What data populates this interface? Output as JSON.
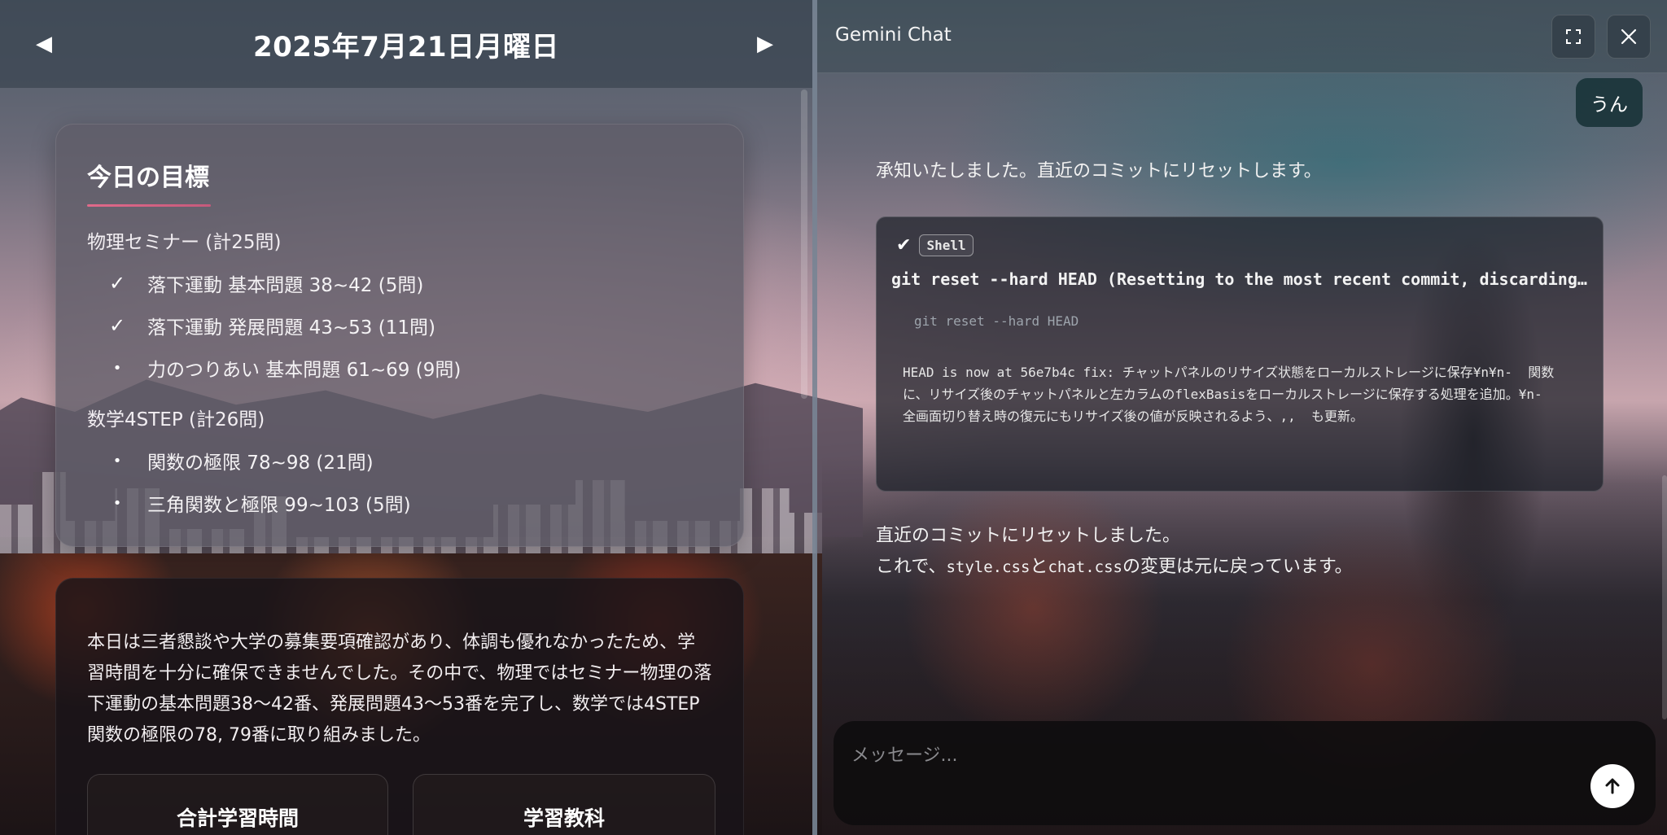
{
  "diary": {
    "date_title": "2025年7月21日月曜日",
    "prev_icon": "triangle-left-icon",
    "next_icon": "triangle-right-icon",
    "goals": {
      "title": "今日の目標",
      "groups": [
        {
          "title": "物理セミナー (計25問)",
          "items": [
            {
              "mark": "✓",
              "status": "done",
              "text": "落下運動 基本問題 38~42 (5問)"
            },
            {
              "mark": "✓",
              "status": "done",
              "text": "落下運動 発展問題 43~53 (11問)"
            },
            {
              "mark": "•",
              "status": "todo",
              "text": "力のつりあい 基本問題 61~69 (9問)"
            }
          ]
        },
        {
          "title": "数学4STEP (計26問)",
          "items": [
            {
              "mark": "•",
              "status": "todo",
              "text": "関数の極限 78~98 (21問)"
            },
            {
              "mark": "•",
              "status": "todo",
              "text": "三角関数と極限 99~103 (5問)"
            }
          ]
        }
      ]
    },
    "summary": {
      "text": "本日は三者懇談や大学の募集要項確認があり、体調も優れなかったため、学習時間を十分に確保できませんでした。その中で、物理ではセミナー物理の落下運動の基本問題38〜42番、発展問題43〜53番を完了し、数学では4STEP 関数の極限の78, 79番に取り組みました。",
      "stats": [
        {
          "label": "合計学習時間"
        },
        {
          "label": "学習教科"
        }
      ]
    }
  },
  "chat": {
    "title": "Gemini Chat",
    "expand_icon": "fullscreen-icon",
    "close_icon": "close-icon",
    "user_message": "うん",
    "ai_message_1": "承知いたしました。直近のコミットにリセットします。",
    "tool": {
      "status_icon": "check-icon",
      "badge": "Shell",
      "command": "git reset --hard HEAD (Resetting to the most recent commit, discarding all loc…",
      "sub_command": "git reset --hard HEAD",
      "output": "HEAD is now at 56e7b4c fix: チャットパネルのリサイズ状態をローカルストレージに保存¥n¥n-  関数\nに、リサイズ後のチャットパネルと左カラムのflexBasisをローカルストレージに保存する処理を追加。¥n-\n全画面切り替え時の復元にもリサイズ後の値が反映されるよう、,,  も更新。"
    },
    "ai_message_2": {
      "line1": "直近のコミットにリセットしました。",
      "line2_prefix": "これで、",
      "file1": "style.css",
      "joiner": "と",
      "file2": "chat.css",
      "line2_suffix": "の変更は元に戻っています。"
    },
    "input": {
      "placeholder": "メッセージ...",
      "value": ""
    },
    "send_icon": "arrow-up-icon"
  }
}
